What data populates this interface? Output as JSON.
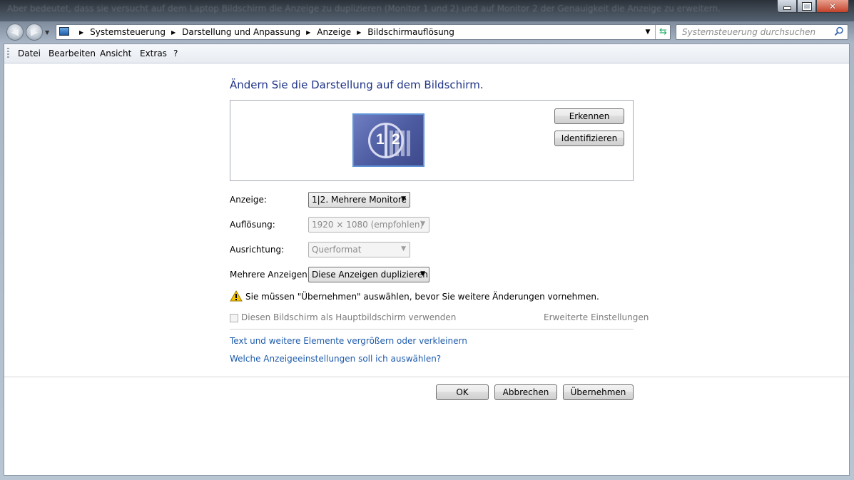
{
  "window": {
    "faded_title": "Aber bedeutet, dass sie versucht auf dem Laptop Bildschirm die Anzeige zu duplizieren (Monitor 1 und 2) und auf Monitor 2 der Genauigkeit die Anzeige zu erweitern."
  },
  "nav": {
    "breadcrumbs": [
      "Systemsteuerung",
      "Darstellung und Anpassung",
      "Anzeige",
      "Bildschirmauflösung"
    ],
    "search_placeholder": "Systemsteuerung durchsuchen"
  },
  "menu": [
    "Datei",
    "Bearbeiten",
    "Ansicht",
    "Extras",
    "?"
  ],
  "page": {
    "heading": "Ändern Sie die Darstellung auf dem Bildschirm.",
    "monitor_numbers": [
      "1",
      "2"
    ],
    "detect_button": "Erkennen",
    "identify_button": "Identifizieren",
    "fields": {
      "display_label": "Anzeige:",
      "display_value": "1|2. Mehrere Monitore",
      "resolution_label": "Auflösung:",
      "resolution_value": "1920 × 1080 (empfohlen)",
      "orientation_label": "Ausrichtung:",
      "orientation_value": "Querformat",
      "multi_label": "Mehrere Anzeigen:",
      "multi_value": "Diese Anzeigen duplizieren"
    },
    "warning": "Sie müssen \"Übernehmen\" auswählen, bevor Sie weitere Änderungen vornehmen.",
    "main_display_checkbox": "Diesen Bildschirm als Hauptbildschirm verwenden",
    "advanced_link": "Erweiterte Einstellungen",
    "link_text_size": "Text und weitere Elemente vergrößern oder verkleinern",
    "link_which_settings": "Welche Anzeigeeinstellungen soll ich auswählen?",
    "ok": "OK",
    "cancel": "Abbrechen",
    "apply": "Übernehmen"
  },
  "colors": {
    "heading": "#1e3287",
    "link": "#1d5aab",
    "disabled": "#7a7a7a"
  }
}
